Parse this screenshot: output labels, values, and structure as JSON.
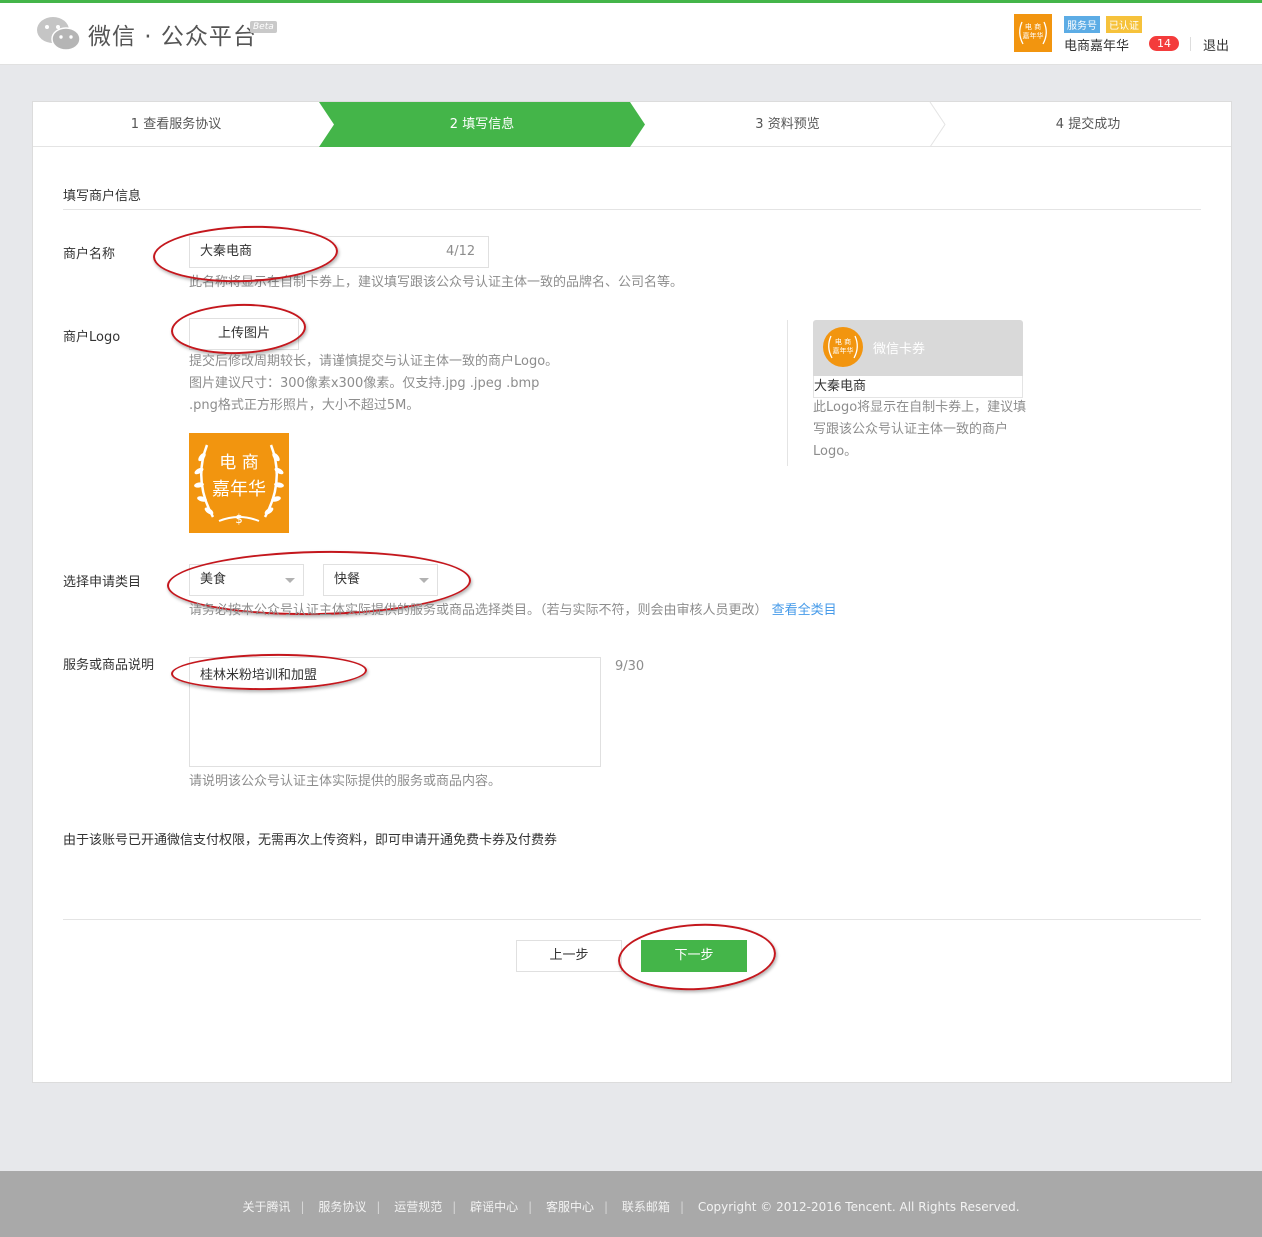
{
  "header": {
    "title": "微信 · 公众平台",
    "beta": "Beta",
    "tag_service": "服务号",
    "tag_verified": "已认证",
    "account_name": "电商嘉年华",
    "message_count": "14",
    "logout": "退出"
  },
  "steps": [
    {
      "label": "1 查看服务协议",
      "state": "done"
    },
    {
      "label": "2 填写信息",
      "state": "active"
    },
    {
      "label": "3 资料预览",
      "state": "todo"
    },
    {
      "label": "4 提交成功",
      "state": "todo"
    }
  ],
  "form": {
    "section_title": "填写商户信息",
    "merchant_name_label": "商户名称",
    "merchant_name_value": "大秦电商",
    "merchant_name_counter": "4/12",
    "merchant_name_hint": "此名称将显示在自制卡券上，建议填写跟该公众号认证主体一致的品牌名、公司名等。",
    "logo_label": "商户Logo",
    "upload_button": "上传图片",
    "logo_hint_1": "提交后修改周期较长，请谨慎提交与认证主体一致的商户Logo。",
    "logo_hint_2": "图片建议尺寸：300像素x300像素。仅支持.jpg .jpeg .bmp",
    "logo_hint_3": ".png格式正方形照片，大小不超过5M。",
    "logo_image_text": {
      "line1": "电 商",
      "line2": "嘉年华",
      "line3": "$"
    },
    "card_title": "微信卡券",
    "card_name": "大秦电商",
    "card_hint": "此Logo将显示在自制卡券上，建议填写跟该公众号认证主体一致的商户Logo。",
    "category_label": "选择申请类目",
    "category_primary": "美食",
    "category_secondary": "快餐",
    "category_hint": "请务必按本公众号认证主体实际提供的服务或商品选择类目。（若与实际不符，则会由审核人员更改）",
    "category_link": "查看全类目",
    "desc_label": "服务或商品说明",
    "desc_value": "桂林米粉培训和加盟",
    "desc_counter": "9/30",
    "desc_hint": "请说明该公众号认证主体实际提供的服务或商品内容。",
    "notice": "由于该账号已开通微信支付权限，无需再次上传资料，即可申请开通免费卡券及付费券",
    "prev_button": "上一步",
    "next_button": "下一步"
  },
  "footer": {
    "links": [
      "关于腾讯",
      "服务协议",
      "运营规范",
      "辟谣中心",
      "客服中心",
      "联系邮箱"
    ],
    "copyright": "Copyright © 2012-2016 Tencent. All Rights Reserved."
  },
  "colors": {
    "brand_green": "#44b549",
    "annotation_red": "#c4171d",
    "logo_orange": "#f2950f"
  }
}
